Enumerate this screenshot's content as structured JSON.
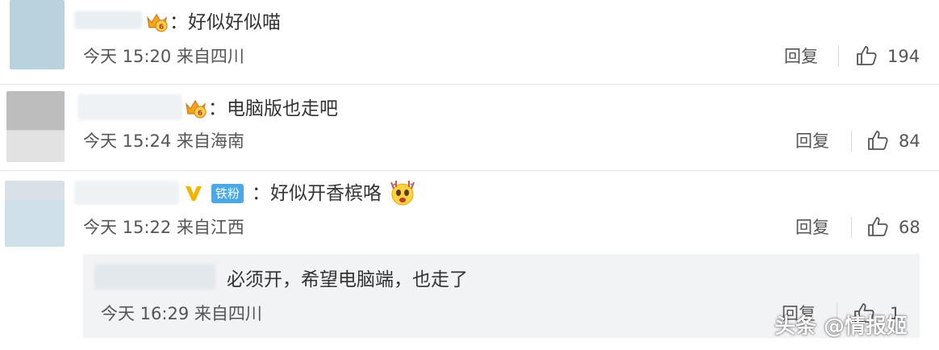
{
  "comments": [
    {
      "text": "：好似好似喵",
      "time": "今天 15:20 来自四川",
      "reply_label": "回复",
      "likes": "194"
    },
    {
      "text": "：电脑版也走吧",
      "time": "今天 15:24 来自海南",
      "reply_label": "回复",
      "likes": "84"
    },
    {
      "badge": "铁粉",
      "text": "：好似开香槟咯",
      "time": "今天 15:22 来自江西",
      "reply_label": "回复",
      "likes": "68",
      "icons": [
        "verified-v-icon",
        "fan-badge",
        "champagne-emoji"
      ]
    }
  ],
  "sub_reply": {
    "text": "必须开，希望电脑端，也走了",
    "time": "今天 16:29 来自四川",
    "reply_label": "回复",
    "likes": "1"
  },
  "watermark": "头条 @情报姬",
  "colors": {
    "badge_blue": "#4aa8e8",
    "verified_gold": "#f5b400",
    "text": "#333333",
    "meta": "#555555",
    "sub_bg": "#f2f3f5"
  }
}
